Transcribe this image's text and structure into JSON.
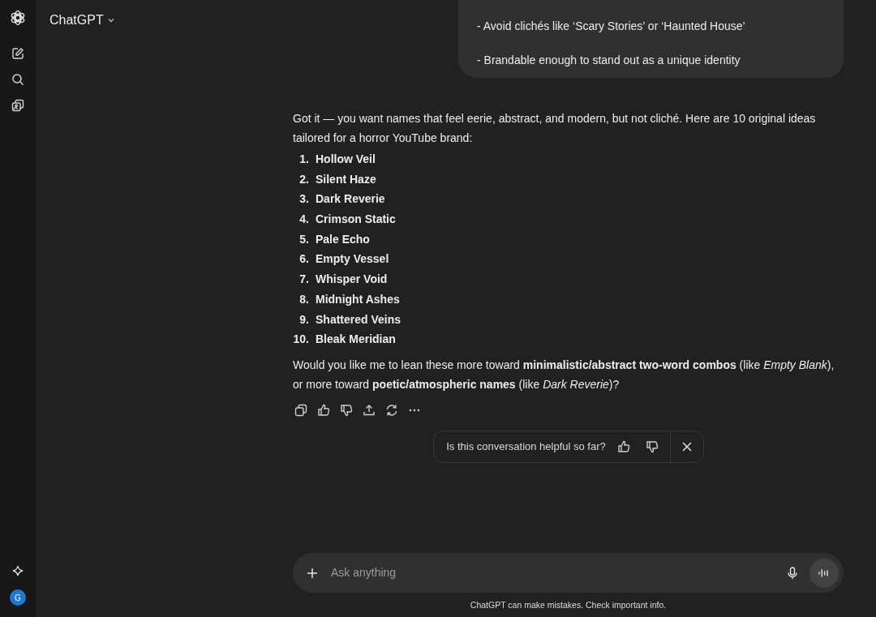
{
  "sidebar": {
    "avatar_initial": "G"
  },
  "header": {
    "model": "ChatGPT"
  },
  "user_message": {
    "lines": [
      "- Avoid clichés like ‘Scary Stories’ or ‘Haunted House’",
      "- Brandable enough to stand out as a unique identity"
    ]
  },
  "assistant_message": {
    "intro": "Got it — you want names that feel eerie, abstract, and modern, but not cliché. Here are 10 original ideas tailored for a horror YouTube brand:",
    "items": [
      {
        "number": "1.",
        "name": "Hollow Veil"
      },
      {
        "number": "2.",
        "name": "Silent Haze"
      },
      {
        "number": "3.",
        "name": "Dark Reverie"
      },
      {
        "number": "4.",
        "name": "Crimson Static"
      },
      {
        "number": "5.",
        "name": "Pale Echo"
      },
      {
        "number": "6.",
        "name": "Empty Vessel"
      },
      {
        "number": "7.",
        "name": "Whisper Void"
      },
      {
        "number": "8.",
        "name": "Midnight Ashes"
      },
      {
        "number": "9.",
        "name": "Shattered Veins"
      },
      {
        "number": "10.",
        "name": "Bleak Meridian"
      }
    ],
    "closing": "Would you like me to lean these more toward **minimalistic/abstract two-word combos** (like *Empty Blank*), or more toward **poetic/atmospheric names** (like *Dark Reverie*)?"
  },
  "feedback": {
    "question": "Is this conversation helpful so far?"
  },
  "composer": {
    "placeholder": "Ask anything"
  },
  "disclaimer": "ChatGPT can make mistakes. Check important info."
}
